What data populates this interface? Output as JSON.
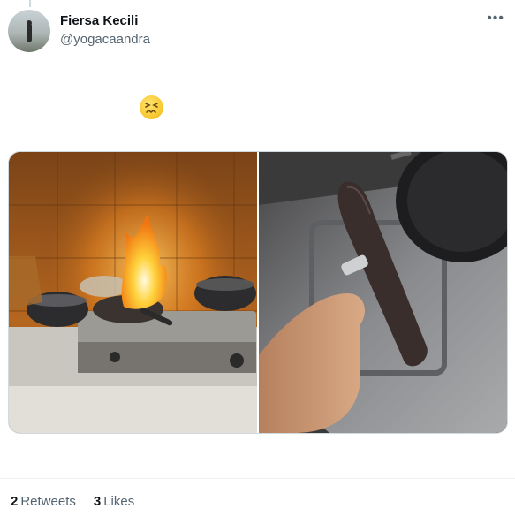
{
  "tweet": {
    "display_name": "Fiersa Kecili",
    "handle": "@yogacaandra",
    "emoji": "confounded-face",
    "more_icon": "•••"
  },
  "media": {
    "photos": [
      {
        "name": "photo-stove-fire",
        "icon": "image"
      },
      {
        "name": "photo-burnt-food",
        "icon": "image"
      }
    ]
  },
  "stats": {
    "retweets_count": "2",
    "retweets_label": "Retweets",
    "likes_count": "3",
    "likes_label": "Likes"
  },
  "colors": {
    "text_primary": "#0f1419",
    "text_secondary": "#536471",
    "border": "#cfd9de"
  }
}
